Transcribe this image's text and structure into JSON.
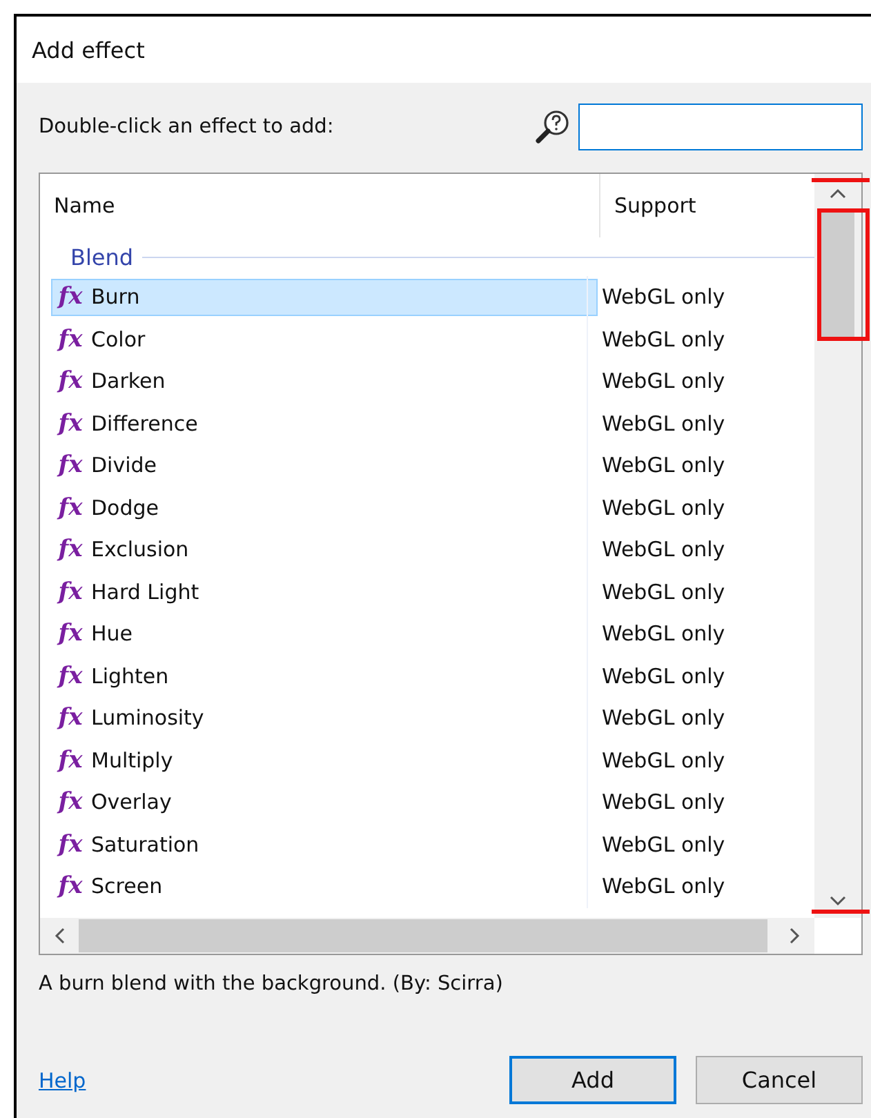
{
  "window": {
    "title": "Add effect"
  },
  "prompt": "Double-click an effect to add:",
  "table": {
    "columns": [
      "Name",
      "Support"
    ],
    "groups": [
      {
        "label": "Blend",
        "rows": [
          {
            "icon_text": "fx",
            "name": "Burn",
            "support": "WebGL only",
            "selected": true
          },
          {
            "icon_text": "fx",
            "name": "Color",
            "support": "WebGL only",
            "selected": false
          },
          {
            "icon_text": "fx",
            "name": "Darken",
            "support": "WebGL only",
            "selected": false
          },
          {
            "icon_text": "fx",
            "name": "Difference",
            "support": "WebGL only",
            "selected": false
          },
          {
            "icon_text": "fx",
            "name": "Divide",
            "support": "WebGL only",
            "selected": false
          },
          {
            "icon_text": "fx",
            "name": "Dodge",
            "support": "WebGL only",
            "selected": false
          },
          {
            "icon_text": "fx",
            "name": "Exclusion",
            "support": "WebGL only",
            "selected": false
          },
          {
            "icon_text": "fx",
            "name": "Hard Light",
            "support": "WebGL only",
            "selected": false
          },
          {
            "icon_text": "fx",
            "name": "Hue",
            "support": "WebGL only",
            "selected": false
          },
          {
            "icon_text": "fx",
            "name": "Lighten",
            "support": "WebGL only",
            "selected": false
          },
          {
            "icon_text": "fx",
            "name": "Luminosity",
            "support": "WebGL only",
            "selected": false
          },
          {
            "icon_text": "fx",
            "name": "Multiply",
            "support": "WebGL only",
            "selected": false
          },
          {
            "icon_text": "fx",
            "name": "Overlay",
            "support": "WebGL only",
            "selected": false
          },
          {
            "icon_text": "fx",
            "name": "Saturation",
            "support": "WebGL only",
            "selected": false
          },
          {
            "icon_text": "fx",
            "name": "Screen",
            "support": "WebGL only",
            "selected": false
          }
        ]
      }
    ]
  },
  "description": "A burn blend with the background. (By: Scirra)",
  "help_link": "Help",
  "buttons": [
    {
      "label": "Add",
      "default": true
    },
    {
      "label": "Cancel",
      "default": false
    }
  ]
}
